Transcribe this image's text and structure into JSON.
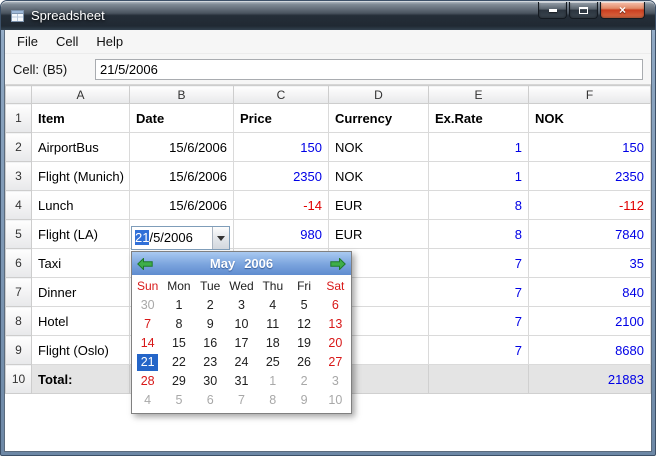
{
  "window": {
    "title": "Spreadsheet",
    "close_glyph": "×"
  },
  "menubar": {
    "items": [
      "File",
      "Cell",
      "Help"
    ]
  },
  "formula": {
    "label": "Cell: (B5)",
    "value": "21/5/2006"
  },
  "combo": {
    "full_value": "21/5/2006",
    "selected_text": "21",
    "rest_text": "/5/2006"
  },
  "sheet": {
    "columns": [
      "A",
      "B",
      "C",
      "D",
      "E",
      "F"
    ],
    "rows": [
      {
        "num": "1",
        "cells": [
          {
            "t": "Item",
            "b": 1
          },
          {
            "t": "Date",
            "b": 1
          },
          {
            "t": "Price",
            "b": 1
          },
          {
            "t": "Currency",
            "b": 1
          },
          {
            "t": "Ex.Rate",
            "b": 1
          },
          {
            "t": "NOK",
            "b": 1
          }
        ]
      },
      {
        "num": "2",
        "cells": [
          {
            "t": "AirportBus"
          },
          {
            "t": "15/6/2006",
            "al": "r"
          },
          {
            "t": "150",
            "al": "r",
            "cl": "blue"
          },
          {
            "t": "NOK"
          },
          {
            "t": "1",
            "al": "r",
            "cl": "blue"
          },
          {
            "t": "150",
            "al": "r",
            "cl": "blue"
          }
        ]
      },
      {
        "num": "3",
        "cells": [
          {
            "t": "Flight (Munich)"
          },
          {
            "t": "15/6/2006",
            "al": "r"
          },
          {
            "t": "2350",
            "al": "r",
            "cl": "blue"
          },
          {
            "t": "NOK"
          },
          {
            "t": "1",
            "al": "r",
            "cl": "blue"
          },
          {
            "t": "2350",
            "al": "r",
            "cl": "blue"
          }
        ]
      },
      {
        "num": "4",
        "cells": [
          {
            "t": "Lunch"
          },
          {
            "t": "15/6/2006",
            "al": "r"
          },
          {
            "t": "-14",
            "al": "r",
            "cl": "red"
          },
          {
            "t": "EUR"
          },
          {
            "t": "8",
            "al": "r",
            "cl": "blue"
          },
          {
            "t": "-112",
            "al": "r",
            "cl": "red"
          }
        ]
      },
      {
        "num": "5",
        "cells": [
          {
            "t": "Flight (LA)"
          },
          {
            "t": "",
            "editor": 1
          },
          {
            "t": "980",
            "al": "r",
            "cl": "blue"
          },
          {
            "t": "EUR"
          },
          {
            "t": "8",
            "al": "r",
            "cl": "blue"
          },
          {
            "t": "7840",
            "al": "r",
            "cl": "blue"
          }
        ]
      },
      {
        "num": "6",
        "cells": [
          {
            "t": "Taxi"
          },
          {
            "t": ""
          },
          {
            "t": ""
          },
          {
            "t": ""
          },
          {
            "t": "7",
            "al": "r",
            "cl": "blue"
          },
          {
            "t": "35",
            "al": "r",
            "cl": "blue"
          }
        ]
      },
      {
        "num": "7",
        "cells": [
          {
            "t": "Dinner"
          },
          {
            "t": ""
          },
          {
            "t": ""
          },
          {
            "t": ""
          },
          {
            "t": "7",
            "al": "r",
            "cl": "blue"
          },
          {
            "t": "840",
            "al": "r",
            "cl": "blue"
          }
        ]
      },
      {
        "num": "8",
        "cells": [
          {
            "t": "Hotel"
          },
          {
            "t": ""
          },
          {
            "t": ""
          },
          {
            "t": ""
          },
          {
            "t": "7",
            "al": "r",
            "cl": "blue"
          },
          {
            "t": "2100",
            "al": "r",
            "cl": "blue"
          }
        ]
      },
      {
        "num": "9",
        "cells": [
          {
            "t": "Flight (Oslo)"
          },
          {
            "t": ""
          },
          {
            "t": ""
          },
          {
            "t": ""
          },
          {
            "t": "7",
            "al": "r",
            "cl": "blue"
          },
          {
            "t": "8680",
            "al": "r",
            "cl": "blue"
          }
        ]
      },
      {
        "num": "10",
        "total": 1,
        "cells": [
          {
            "t": "Total:",
            "b": 1
          },
          {
            "t": ""
          },
          {
            "t": ""
          },
          {
            "t": ""
          },
          {
            "t": ""
          },
          {
            "t": "21883",
            "al": "r",
            "cl": "blue"
          }
        ]
      }
    ]
  },
  "calendar": {
    "month": "May",
    "year": "2006",
    "weekdays": [
      {
        "t": "Sun",
        "red": 1
      },
      {
        "t": "Mon"
      },
      {
        "t": "Tue"
      },
      {
        "t": "Wed"
      },
      {
        "t": "Thu"
      },
      {
        "t": "Fri"
      },
      {
        "t": "Sat",
        "red": 1
      }
    ],
    "weeks": [
      [
        {
          "d": "30",
          "s": "m"
        },
        {
          "d": "1",
          "s": "n"
        },
        {
          "d": "2",
          "s": "n"
        },
        {
          "d": "3",
          "s": "n"
        },
        {
          "d": "4",
          "s": "n"
        },
        {
          "d": "5",
          "s": "n"
        },
        {
          "d": "6",
          "s": "w"
        }
      ],
      [
        {
          "d": "7",
          "s": "w"
        },
        {
          "d": "8",
          "s": "n"
        },
        {
          "d": "9",
          "s": "n"
        },
        {
          "d": "10",
          "s": "n"
        },
        {
          "d": "11",
          "s": "n"
        },
        {
          "d": "12",
          "s": "n"
        },
        {
          "d": "13",
          "s": "w"
        }
      ],
      [
        {
          "d": "14",
          "s": "w"
        },
        {
          "d": "15",
          "s": "n"
        },
        {
          "d": "16",
          "s": "n"
        },
        {
          "d": "17",
          "s": "n"
        },
        {
          "d": "18",
          "s": "n"
        },
        {
          "d": "19",
          "s": "n"
        },
        {
          "d": "20",
          "s": "w"
        }
      ],
      [
        {
          "d": "21",
          "s": "sel"
        },
        {
          "d": "22",
          "s": "n"
        },
        {
          "d": "23",
          "s": "n"
        },
        {
          "d": "24",
          "s": "n"
        },
        {
          "d": "25",
          "s": "n"
        },
        {
          "d": "26",
          "s": "n"
        },
        {
          "d": "27",
          "s": "w"
        }
      ],
      [
        {
          "d": "28",
          "s": "w"
        },
        {
          "d": "29",
          "s": "n"
        },
        {
          "d": "30",
          "s": "n"
        },
        {
          "d": "31",
          "s": "n"
        },
        {
          "d": "1",
          "s": "m"
        },
        {
          "d": "2",
          "s": "m"
        },
        {
          "d": "3",
          "s": "m"
        }
      ],
      [
        {
          "d": "4",
          "s": "m"
        },
        {
          "d": "5",
          "s": "m"
        },
        {
          "d": "6",
          "s": "m"
        },
        {
          "d": "7",
          "s": "m"
        },
        {
          "d": "8",
          "s": "m"
        },
        {
          "d": "9",
          "s": "m"
        },
        {
          "d": "10",
          "s": "m"
        }
      ]
    ]
  },
  "colors": {
    "positive_value": "#0000e6",
    "negative_value": "#e10000",
    "weekend": "#d81818",
    "adjacent_month": "#a8a8a8",
    "selected_day_bg": "#2465c8",
    "selection_highlight": "#3070d8",
    "total_row_bg": "#e4e4e4",
    "arrow_green": "#3fae49"
  },
  "icons": {
    "minimize": "–",
    "maximize": "▭",
    "close": "×",
    "combo_dropdown": "▾",
    "prev_month": "◀",
    "next_month": "▶"
  }
}
